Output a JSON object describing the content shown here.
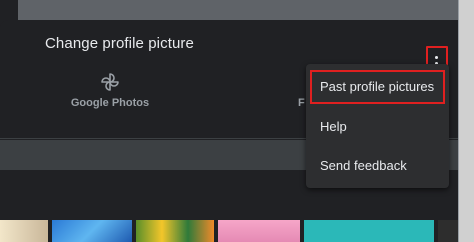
{
  "dialog": {
    "title": "Change profile picture"
  },
  "tabs": [
    {
      "label": "Google Photos",
      "icon": "pinwheel-icon"
    },
    {
      "label": "F"
    }
  ],
  "more_menu": {
    "icon": "more-vert-icon",
    "items": [
      {
        "label": "Past profile pictures"
      },
      {
        "label": "Help"
      },
      {
        "label": "Send feedback"
      }
    ]
  },
  "colors": {
    "dialog_background": "#202124",
    "menu_background": "#2d2e30",
    "highlight": "#e02020",
    "text_primary": "#e8eaed",
    "text_secondary": "#9aa0a6"
  }
}
